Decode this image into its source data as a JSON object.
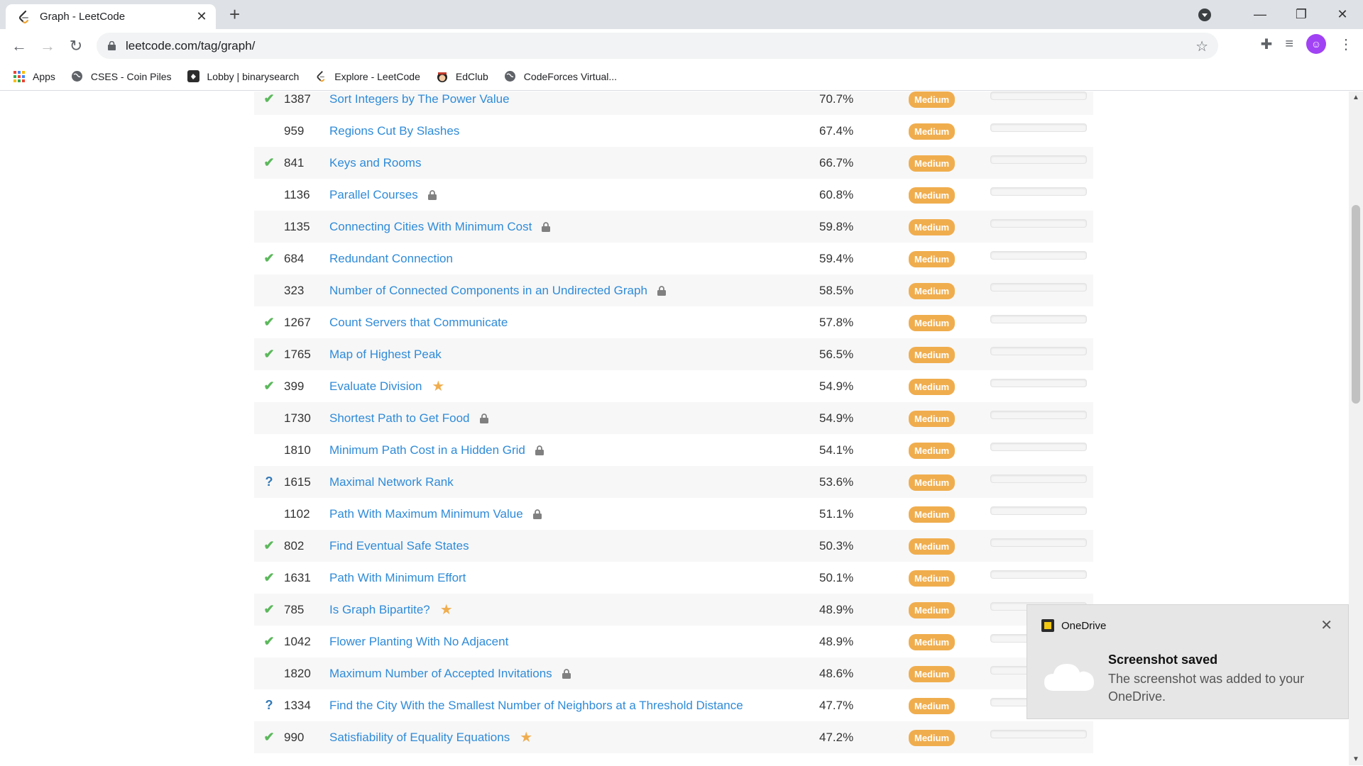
{
  "browser": {
    "tab_title": "Graph - LeetCode",
    "url": "leetcode.com/tag/graph/",
    "bookmarks": [
      {
        "label": "Apps",
        "icon": "apps-grid-icon"
      },
      {
        "label": "CSES - Coin Piles",
        "icon": "globe-icon"
      },
      {
        "label": "Lobby | binarysearch",
        "icon": "binarysearch-icon"
      },
      {
        "label": "Explore - LeetCode",
        "icon": "leetcode-icon"
      },
      {
        "label": "EdClub",
        "icon": "edclub-icon"
      },
      {
        "label": "CodeForces Virtual...",
        "icon": "globe-icon"
      }
    ]
  },
  "colors": {
    "link": "#2f8bd8",
    "solved": "#5cb85c",
    "medium_badge": "#f0ad4e"
  },
  "problems": [
    {
      "status": "solved",
      "id": "1387",
      "title": "Sort Integers by The Power Value",
      "locked": false,
      "starred": false,
      "acceptance": "70.7%",
      "difficulty": "Medium"
    },
    {
      "status": "",
      "id": "959",
      "title": "Regions Cut By Slashes",
      "locked": false,
      "starred": false,
      "acceptance": "67.4%",
      "difficulty": "Medium"
    },
    {
      "status": "solved",
      "id": "841",
      "title": "Keys and Rooms",
      "locked": false,
      "starred": false,
      "acceptance": "66.7%",
      "difficulty": "Medium"
    },
    {
      "status": "",
      "id": "1136",
      "title": "Parallel Courses",
      "locked": true,
      "starred": false,
      "acceptance": "60.8%",
      "difficulty": "Medium"
    },
    {
      "status": "",
      "id": "1135",
      "title": "Connecting Cities With Minimum Cost",
      "locked": true,
      "starred": false,
      "acceptance": "59.8%",
      "difficulty": "Medium"
    },
    {
      "status": "solved",
      "id": "684",
      "title": "Redundant Connection",
      "locked": false,
      "starred": false,
      "acceptance": "59.4%",
      "difficulty": "Medium"
    },
    {
      "status": "",
      "id": "323",
      "title": "Number of Connected Components in an Undirected Graph",
      "locked": true,
      "starred": false,
      "acceptance": "58.5%",
      "difficulty": "Medium"
    },
    {
      "status": "solved",
      "id": "1267",
      "title": "Count Servers that Communicate",
      "locked": false,
      "starred": false,
      "acceptance": "57.8%",
      "difficulty": "Medium"
    },
    {
      "status": "solved",
      "id": "1765",
      "title": "Map of Highest Peak",
      "locked": false,
      "starred": false,
      "acceptance": "56.5%",
      "difficulty": "Medium"
    },
    {
      "status": "solved",
      "id": "399",
      "title": "Evaluate Division",
      "locked": false,
      "starred": true,
      "acceptance": "54.9%",
      "difficulty": "Medium"
    },
    {
      "status": "",
      "id": "1730",
      "title": "Shortest Path to Get Food",
      "locked": true,
      "starred": false,
      "acceptance": "54.9%",
      "difficulty": "Medium"
    },
    {
      "status": "",
      "id": "1810",
      "title": "Minimum Path Cost in a Hidden Grid",
      "locked": true,
      "starred": false,
      "acceptance": "54.1%",
      "difficulty": "Medium"
    },
    {
      "status": "attempted",
      "id": "1615",
      "title": "Maximal Network Rank",
      "locked": false,
      "starred": false,
      "acceptance": "53.6%",
      "difficulty": "Medium"
    },
    {
      "status": "",
      "id": "1102",
      "title": "Path With Maximum Minimum Value",
      "locked": true,
      "starred": false,
      "acceptance": "51.1%",
      "difficulty": "Medium"
    },
    {
      "status": "solved",
      "id": "802",
      "title": "Find Eventual Safe States",
      "locked": false,
      "starred": false,
      "acceptance": "50.3%",
      "difficulty": "Medium"
    },
    {
      "status": "solved",
      "id": "1631",
      "title": "Path With Minimum Effort",
      "locked": false,
      "starred": false,
      "acceptance": "50.1%",
      "difficulty": "Medium"
    },
    {
      "status": "solved",
      "id": "785",
      "title": "Is Graph Bipartite?",
      "locked": false,
      "starred": true,
      "acceptance": "48.9%",
      "difficulty": "Medium"
    },
    {
      "status": "solved",
      "id": "1042",
      "title": "Flower Planting With No Adjacent",
      "locked": false,
      "starred": false,
      "acceptance": "48.9%",
      "difficulty": "Medium"
    },
    {
      "status": "",
      "id": "1820",
      "title": "Maximum Number of Accepted Invitations",
      "locked": true,
      "starred": false,
      "acceptance": "48.6%",
      "difficulty": "Medium"
    },
    {
      "status": "attempted",
      "id": "1334",
      "title": "Find the City With the Smallest Number of Neighbors at a Threshold Distance",
      "locked": false,
      "starred": false,
      "acceptance": "47.7%",
      "difficulty": "Medium"
    },
    {
      "status": "solved",
      "id": "990",
      "title": "Satisfiability of Equality Equations",
      "locked": false,
      "starred": true,
      "acceptance": "47.2%",
      "difficulty": "Medium"
    }
  ],
  "toast": {
    "app": "OneDrive",
    "heading": "Screenshot saved",
    "message": "The screenshot was added to your OneDrive."
  }
}
